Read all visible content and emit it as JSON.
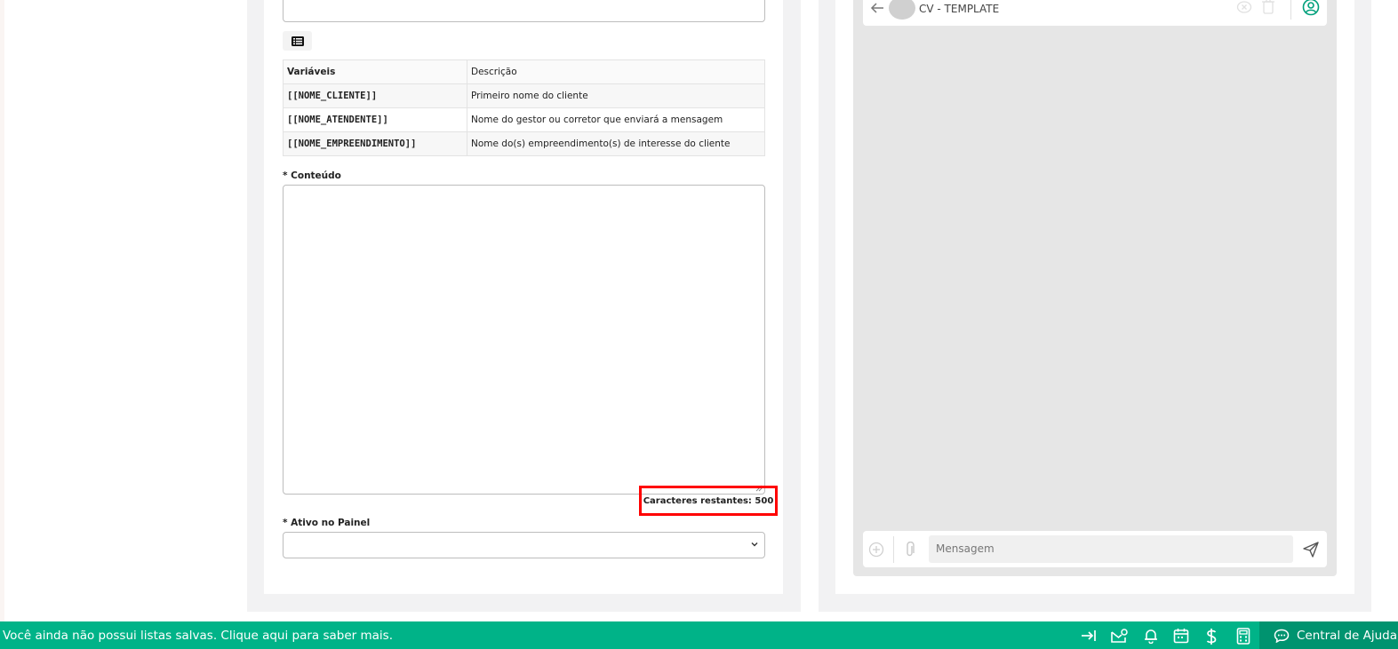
{
  "form": {
    "table": {
      "headers": [
        "Variáveis",
        "Descrição"
      ],
      "rows": [
        {
          "variable": "[[NOME_CLIENTE]]",
          "description": "Primeiro nome do cliente"
        },
        {
          "variable": "[[NOME_ATENDENTE]]",
          "description": "Nome do gestor ou corretor que enviará a mensagem"
        },
        {
          "variable": "[[NOME_EMPREENDIMENTO]]",
          "description": "Nome do(s) empreendimento(s) de interesse do cliente"
        }
      ]
    },
    "content_label": "* Conteúdo",
    "content_value": "",
    "char_counter": "Caracteres restantes: 500",
    "active_label": "* Ativo no Painel",
    "active_value": ""
  },
  "preview": {
    "title": "CV - TEMPLATE",
    "message_placeholder": "Mensagem"
  },
  "status_bar": {
    "message": "Você ainda não possui listas salvas. Clique aqui para saber mais.",
    "help_label": "Central de Ajuda",
    "icons": [
      "collapse-icon",
      "mail-settings-icon",
      "bell-icon",
      "calendar-icon",
      "dollar-icon",
      "calculator-icon",
      "chat-help-icon"
    ]
  },
  "colors": {
    "accent": "#00b388",
    "accent_dark": "#00936f",
    "highlight": "#ff0000"
  }
}
